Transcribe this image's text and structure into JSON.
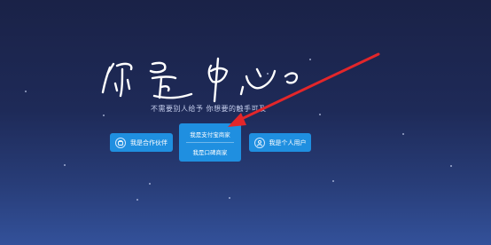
{
  "hero": {
    "logo_text": "你是中心",
    "subtitle": "不需要别人给予 你想要的触手可及"
  },
  "buttons": {
    "partner": {
      "label": "我是合作伙伴",
      "icon": "partner-icon"
    },
    "alipay_merchant": {
      "label": "我是支付宝商家"
    },
    "koubei_merchant": {
      "label": "我是口碑商家"
    },
    "personal": {
      "label": "我是个人用户",
      "icon": "user-icon"
    }
  },
  "colors": {
    "background_top": "#1a2247",
    "background_bottom": "#33519a",
    "button": "#1f8fe0",
    "annotation_arrow": "#e3262a"
  }
}
